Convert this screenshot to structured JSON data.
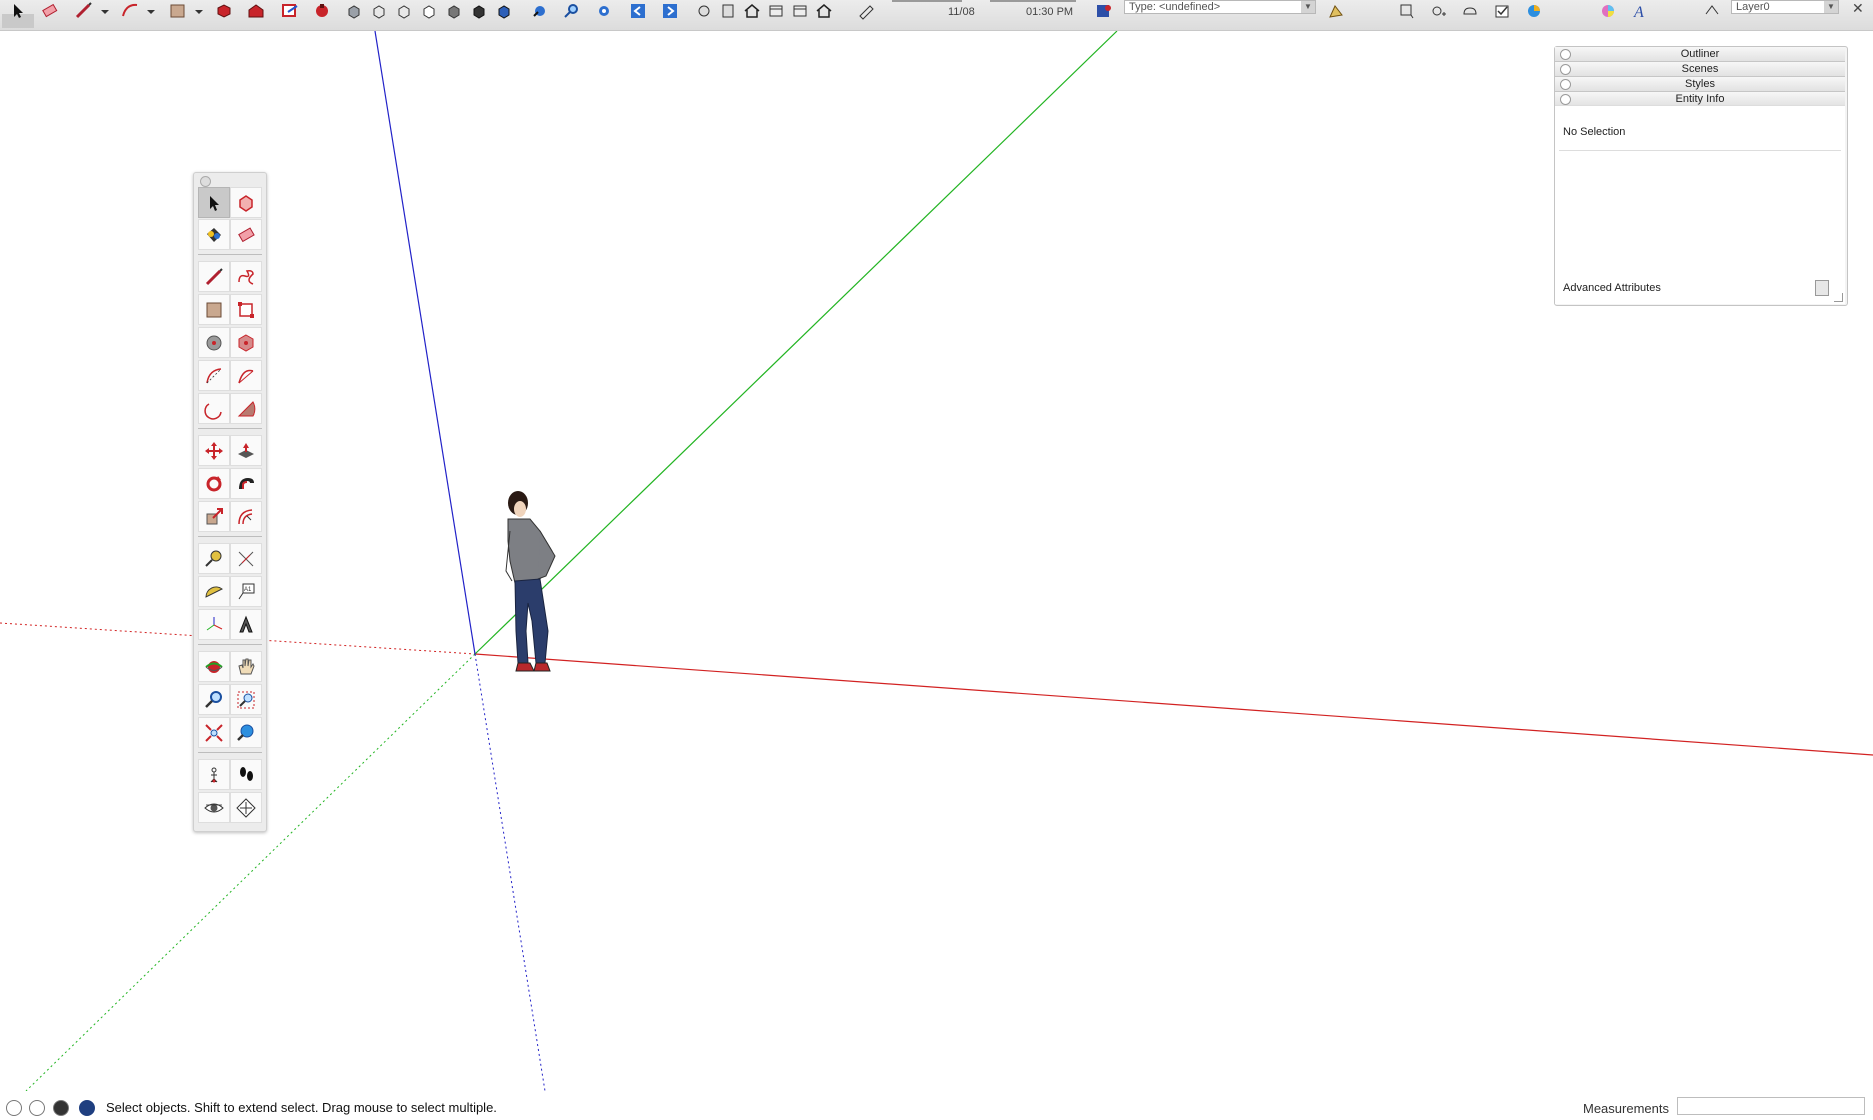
{
  "toolbar": {
    "date_label": "11/08",
    "time_label": "01:30 PM",
    "type_select_value": "Type: <undefined>",
    "layer_select_value": "Layer0",
    "icons": [
      "select-arrow",
      "eraser",
      "pencil-line",
      "arc",
      "rectangle",
      "paint-bucket",
      "components",
      "warehouse",
      "send-to-layout",
      "extension-warehouse",
      "iso-view",
      "top-view",
      "front-view",
      "right-view",
      "back-view",
      "left-view",
      "orbit",
      "zoom",
      "zoom-extents",
      "previous-view",
      "next-view",
      "section-plane",
      "model-info",
      "home",
      "x-ray",
      "back-edges",
      "shadows",
      "fog",
      "entity-info",
      "add-location",
      "3d-text",
      "color-picker",
      "style-a",
      "layer-manager"
    ]
  },
  "palette": {
    "tools": [
      "select",
      "make-component",
      "paint-bucket",
      "eraser",
      "line",
      "freehand",
      "rectangle",
      "rotated-rectangle",
      "circle",
      "polygon",
      "arc",
      "2-point-arc",
      "3-point-arc",
      "pie",
      "move",
      "push-pull",
      "rotate",
      "follow-me",
      "scale",
      "offset",
      "tape-measure",
      "dimension",
      "protractor",
      "text",
      "axes",
      "3d-text",
      "orbit",
      "pan",
      "zoom",
      "zoom-window",
      "zoom-extents",
      "previous",
      "position-camera",
      "walk",
      "look-around",
      "section-plane"
    ]
  },
  "tray": {
    "panels": [
      "Outliner",
      "Scenes",
      "Styles",
      "Entity Info"
    ],
    "entity_info": {
      "selection": "No Selection",
      "advanced": "Advanced Attributes"
    }
  },
  "status": {
    "message": "Select objects. Shift to extend select. Drag mouse to select multiple.",
    "measurements_label": "Measurements",
    "measurements_value": ""
  },
  "colors": {
    "axis_red": "#d22222",
    "axis_green": "#22b422",
    "axis_blue": "#2222c8",
    "tool_red": "#c8242a"
  }
}
